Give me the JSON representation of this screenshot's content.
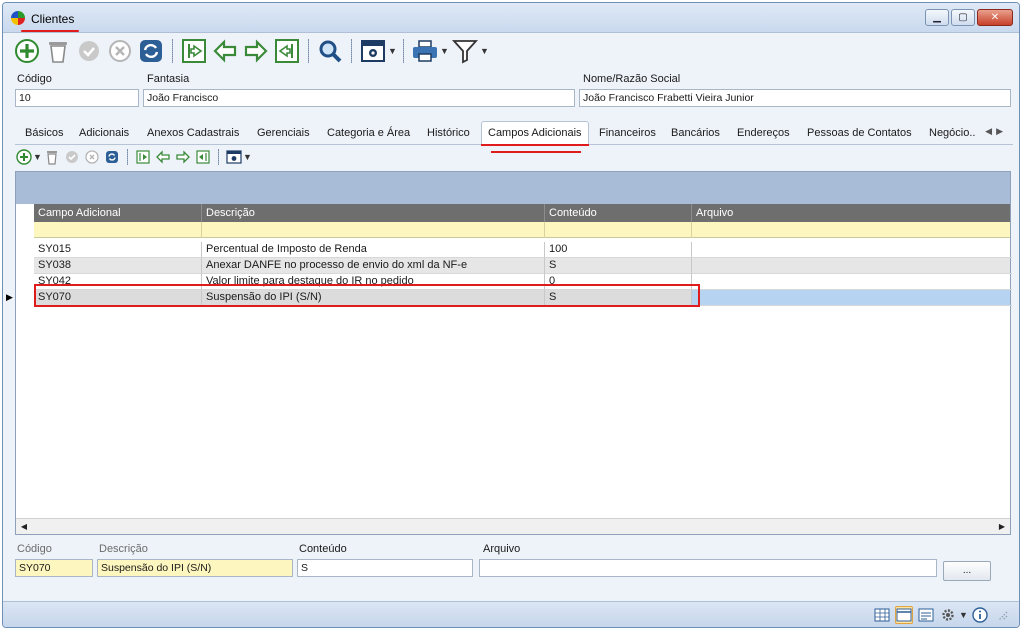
{
  "window": {
    "title": "Clientes",
    "buttons": {
      "minimize": "▁",
      "maximize": "▢",
      "close": "✕"
    }
  },
  "toolbar": {
    "icons": [
      "add-icon",
      "delete-icon",
      "confirm-icon",
      "cancel-icon",
      "refresh-icon",
      "first-record-icon",
      "previous-record-icon",
      "next-record-icon",
      "last-record-icon",
      "search-icon",
      "settings-icon",
      "print-icon",
      "filter-icon"
    ]
  },
  "header": {
    "codigo_label": "Código",
    "codigo_value": "10",
    "fantasia_label": "Fantasia",
    "fantasia_value": "João Francisco",
    "razao_label": "Nome/Razão Social",
    "razao_value": "João Francisco Frabetti Vieira Junior"
  },
  "tabs": [
    {
      "label": "Básicos"
    },
    {
      "label": "Adicionais"
    },
    {
      "label": "Anexos Cadastrais"
    },
    {
      "label": "Gerenciais"
    },
    {
      "label": "Categoria e Área"
    },
    {
      "label": "Histórico"
    },
    {
      "label": "Campos Adicionais"
    },
    {
      "label": "Financeiros"
    },
    {
      "label": "Bancários"
    },
    {
      "label": "Endereços"
    },
    {
      "label": "Pessoas de Contatos"
    },
    {
      "label": "Negócio.."
    }
  ],
  "active_tab": "Campos Adicionais",
  "grid": {
    "columns": [
      "Campo Adicional",
      "Descrição",
      "Conteúdo",
      "Arquivo"
    ],
    "rows": [
      {
        "campo": "SY015",
        "descricao": "Percentual de Imposto de Renda",
        "conteudo": "100",
        "arquivo": ""
      },
      {
        "campo": "SY038",
        "descricao": "Anexar DANFE no processo de envio do xml da NF-e",
        "conteudo": "S",
        "arquivo": ""
      },
      {
        "campo": "SY042",
        "descricao": "Valor limite para destaque do IR no pedido",
        "conteudo": "0",
        "arquivo": ""
      },
      {
        "campo": "SY070",
        "descricao": "Suspensão do IPI (S/N)",
        "conteudo": "S",
        "arquivo": ""
      }
    ],
    "selected_row": 3
  },
  "detail": {
    "codigo_label": "Código",
    "codigo_value": "SY070",
    "descricao_label": "Descrição",
    "descricao_value": "Suspensão do IPI (S/N)",
    "conteudo_label": "Conteúdo",
    "conteudo_value": "S",
    "arquivo_label": "Arquivo",
    "arquivo_value": "",
    "browse_label": "..."
  },
  "colors": {
    "highlight_red": "#e01b1b",
    "selected_row": "#b7d3f2",
    "grid_header": "#6e6e6e",
    "group_band": "#a8bcd8",
    "filter_row": "#fdf6be"
  }
}
